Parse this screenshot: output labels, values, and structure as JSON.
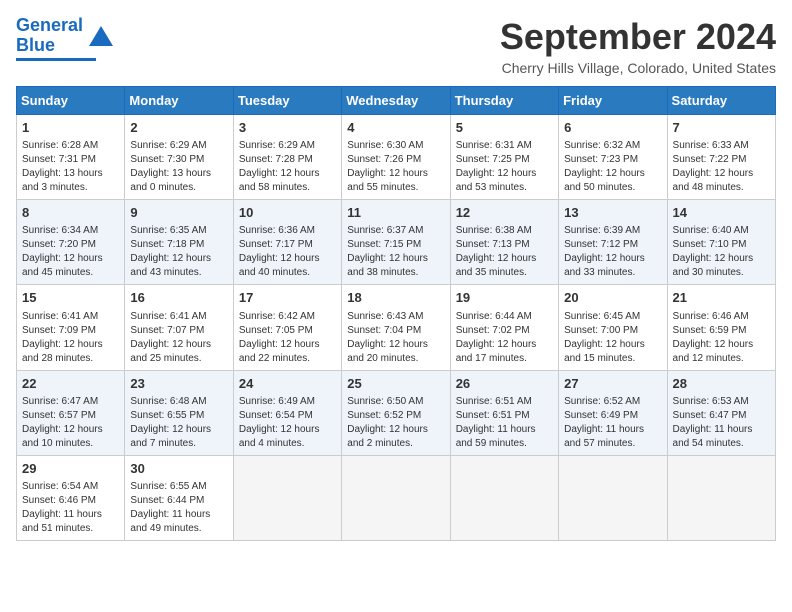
{
  "header": {
    "logo_line1": "General",
    "logo_line2": "Blue",
    "month_title": "September 2024",
    "location": "Cherry Hills Village, Colorado, United States"
  },
  "weekdays": [
    "Sunday",
    "Monday",
    "Tuesday",
    "Wednesday",
    "Thursday",
    "Friday",
    "Saturday"
  ],
  "weeks": [
    [
      {
        "day": "1",
        "sunrise": "6:28 AM",
        "sunset": "7:31 PM",
        "daylight": "13 hours and 3 minutes."
      },
      {
        "day": "2",
        "sunrise": "6:29 AM",
        "sunset": "7:30 PM",
        "daylight": "13 hours and 0 minutes."
      },
      {
        "day": "3",
        "sunrise": "6:29 AM",
        "sunset": "7:28 PM",
        "daylight": "12 hours and 58 minutes."
      },
      {
        "day": "4",
        "sunrise": "6:30 AM",
        "sunset": "7:26 PM",
        "daylight": "12 hours and 55 minutes."
      },
      {
        "day": "5",
        "sunrise": "6:31 AM",
        "sunset": "7:25 PM",
        "daylight": "12 hours and 53 minutes."
      },
      {
        "day": "6",
        "sunrise": "6:32 AM",
        "sunset": "7:23 PM",
        "daylight": "12 hours and 50 minutes."
      },
      {
        "day": "7",
        "sunrise": "6:33 AM",
        "sunset": "7:22 PM",
        "daylight": "12 hours and 48 minutes."
      }
    ],
    [
      {
        "day": "8",
        "sunrise": "6:34 AM",
        "sunset": "7:20 PM",
        "daylight": "12 hours and 45 minutes."
      },
      {
        "day": "9",
        "sunrise": "6:35 AM",
        "sunset": "7:18 PM",
        "daylight": "12 hours and 43 minutes."
      },
      {
        "day": "10",
        "sunrise": "6:36 AM",
        "sunset": "7:17 PM",
        "daylight": "12 hours and 40 minutes."
      },
      {
        "day": "11",
        "sunrise": "6:37 AM",
        "sunset": "7:15 PM",
        "daylight": "12 hours and 38 minutes."
      },
      {
        "day": "12",
        "sunrise": "6:38 AM",
        "sunset": "7:13 PM",
        "daylight": "12 hours and 35 minutes."
      },
      {
        "day": "13",
        "sunrise": "6:39 AM",
        "sunset": "7:12 PM",
        "daylight": "12 hours and 33 minutes."
      },
      {
        "day": "14",
        "sunrise": "6:40 AM",
        "sunset": "7:10 PM",
        "daylight": "12 hours and 30 minutes."
      }
    ],
    [
      {
        "day": "15",
        "sunrise": "6:41 AM",
        "sunset": "7:09 PM",
        "daylight": "12 hours and 28 minutes."
      },
      {
        "day": "16",
        "sunrise": "6:41 AM",
        "sunset": "7:07 PM",
        "daylight": "12 hours and 25 minutes."
      },
      {
        "day": "17",
        "sunrise": "6:42 AM",
        "sunset": "7:05 PM",
        "daylight": "12 hours and 22 minutes."
      },
      {
        "day": "18",
        "sunrise": "6:43 AM",
        "sunset": "7:04 PM",
        "daylight": "12 hours and 20 minutes."
      },
      {
        "day": "19",
        "sunrise": "6:44 AM",
        "sunset": "7:02 PM",
        "daylight": "12 hours and 17 minutes."
      },
      {
        "day": "20",
        "sunrise": "6:45 AM",
        "sunset": "7:00 PM",
        "daylight": "12 hours and 15 minutes."
      },
      {
        "day": "21",
        "sunrise": "6:46 AM",
        "sunset": "6:59 PM",
        "daylight": "12 hours and 12 minutes."
      }
    ],
    [
      {
        "day": "22",
        "sunrise": "6:47 AM",
        "sunset": "6:57 PM",
        "daylight": "12 hours and 10 minutes."
      },
      {
        "day": "23",
        "sunrise": "6:48 AM",
        "sunset": "6:55 PM",
        "daylight": "12 hours and 7 minutes."
      },
      {
        "day": "24",
        "sunrise": "6:49 AM",
        "sunset": "6:54 PM",
        "daylight": "12 hours and 4 minutes."
      },
      {
        "day": "25",
        "sunrise": "6:50 AM",
        "sunset": "6:52 PM",
        "daylight": "12 hours and 2 minutes."
      },
      {
        "day": "26",
        "sunrise": "6:51 AM",
        "sunset": "6:51 PM",
        "daylight": "11 hours and 59 minutes."
      },
      {
        "day": "27",
        "sunrise": "6:52 AM",
        "sunset": "6:49 PM",
        "daylight": "11 hours and 57 minutes."
      },
      {
        "day": "28",
        "sunrise": "6:53 AM",
        "sunset": "6:47 PM",
        "daylight": "11 hours and 54 minutes."
      }
    ],
    [
      {
        "day": "29",
        "sunrise": "6:54 AM",
        "sunset": "6:46 PM",
        "daylight": "11 hours and 51 minutes."
      },
      {
        "day": "30",
        "sunrise": "6:55 AM",
        "sunset": "6:44 PM",
        "daylight": "11 hours and 49 minutes."
      },
      null,
      null,
      null,
      null,
      null
    ]
  ],
  "labels": {
    "sunrise": "Sunrise:",
    "sunset": "Sunset:",
    "daylight": "Daylight:"
  }
}
